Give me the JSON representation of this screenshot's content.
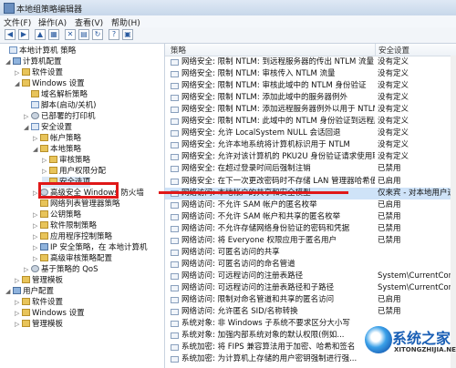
{
  "window": {
    "title": "本地组策略编辑器"
  },
  "menu": [
    "文件(F)",
    "操作(A)",
    "查看(V)",
    "帮助(H)"
  ],
  "tree": [
    {
      "label": "本地计算机 策略",
      "icon": "policy-icon",
      "exp": ""
    },
    {
      "label": "计算机配置",
      "icon": "computer-icon",
      "exp": "◢"
    },
    {
      "label": "软件设置",
      "icon": "folder-icon",
      "exp": "▷"
    },
    {
      "label": "Windows 设置",
      "icon": "folder-icon",
      "exp": "◢"
    },
    {
      "label": "域名解析策略",
      "icon": "folder-icon",
      "exp": ""
    },
    {
      "label": "脚本(启动/关机)",
      "icon": "script-icon",
      "exp": ""
    },
    {
      "label": "已部署的打印机",
      "icon": "printer-icon",
      "exp": "▷"
    },
    {
      "label": "安全设置",
      "icon": "security-icon",
      "exp": "◢"
    },
    {
      "label": "帐户策略",
      "icon": "folder-icon",
      "exp": "▷"
    },
    {
      "label": "本地策略",
      "icon": "folder-icon",
      "exp": "◢"
    },
    {
      "label": "审核策略",
      "icon": "folder-icon",
      "exp": "▷"
    },
    {
      "label": "用户权限分配",
      "icon": "folder-icon",
      "exp": "▷"
    },
    {
      "label": "安全选项",
      "icon": "folder-icon",
      "exp": ""
    },
    {
      "label": "高级安全 Windows 防火墙",
      "icon": "firewall-icon",
      "exp": "▷"
    },
    {
      "label": "网络列表管理器策略",
      "icon": "folder-icon",
      "exp": ""
    },
    {
      "label": "公钥策略",
      "icon": "folder-icon",
      "exp": "▷"
    },
    {
      "label": "软件限制策略",
      "icon": "folder-icon",
      "exp": "▷"
    },
    {
      "label": "应用程序控制策略",
      "icon": "folder-icon",
      "exp": "▷"
    },
    {
      "label": "IP 安全策略，在 本地计算机",
      "icon": "ipsec-icon",
      "exp": "▷"
    },
    {
      "label": "高级审核策略配置",
      "icon": "folder-icon",
      "exp": "▷"
    },
    {
      "label": "基于策略的 QoS",
      "icon": "qos-icon",
      "exp": "▷"
    },
    {
      "label": "管理模板",
      "icon": "folder-icon",
      "exp": "▷"
    },
    {
      "label": "用户配置",
      "icon": "user-icon",
      "exp": "◢"
    },
    {
      "label": "软件设置",
      "icon": "folder-icon",
      "exp": "▷"
    },
    {
      "label": "Windows 设置",
      "icon": "folder-icon",
      "exp": "▷"
    },
    {
      "label": "管理模板",
      "icon": "folder-icon",
      "exp": "▷"
    }
  ],
  "columns": {
    "policy": "策略",
    "setting": "安全设置"
  },
  "policies": [
    {
      "name": "网络安全: 限制 NTLM: 到远程服务器的传出 NTLM 流量",
      "value": "没有定义"
    },
    {
      "name": "网络安全: 限制 NTLM: 审核传入 NTLM 流量",
      "value": "没有定义"
    },
    {
      "name": "网络安全: 限制 NTLM: 审核此域中的 NTLM 身份验证",
      "value": "没有定义"
    },
    {
      "name": "网络安全: 限制 NTLM: 添加此域中的服务器例外",
      "value": "没有定义"
    },
    {
      "name": "网络安全: 限制 NTLM: 添加远程服务器例外以用于 NTLM 身份验证",
      "value": "没有定义"
    },
    {
      "name": "网络安全: 限制 NTLM: 此域中的 NTLM 身份验证到远程服务器...",
      "value": "没有定义"
    },
    {
      "name": "网络安全: 允许 LocalSystem NULL 会话回退",
      "value": "没有定义"
    },
    {
      "name": "网络安全: 允许本地系统将计算机标识用于 NTLM",
      "value": "没有定义"
    },
    {
      "name": "网络安全: 允许对该计算机的 PKU2U 身份验证请求使用联...",
      "value": "没有定义"
    },
    {
      "name": "网络安全: 在超过登录时间后强制注销",
      "value": "已禁用"
    },
    {
      "name": "网络安全: 在下一次更改密码时不存储 LAN 管理器哈希值",
      "value": "已启用"
    },
    {
      "name": "网络访问: 本地帐户的共享和安全模型",
      "value": "仅来宾 - 对本地用户进..."
    },
    {
      "name": "网络访问: 不允许 SAM 帐户的匿名枚举",
      "value": "已启用"
    },
    {
      "name": "网络访问: 不允许 SAM 帐户和共享的匿名枚举",
      "value": "已禁用"
    },
    {
      "name": "网络访问: 不允许存储网络身份验证的密码和凭据",
      "value": "已禁用"
    },
    {
      "name": "网络访问: 将 Everyone 权限应用于匿名用户",
      "value": "已禁用"
    },
    {
      "name": "网络访问: 可匿名访问的共享",
      "value": ""
    },
    {
      "name": "网络访问: 可匿名访问的命名管道",
      "value": ""
    },
    {
      "name": "网络访问: 可远程访问的注册表路径",
      "value": "System\\CurrentContro..."
    },
    {
      "name": "网络访问: 可远程访问的注册表路径和子路径",
      "value": "System\\CurrentContro..."
    },
    {
      "name": "网络访问: 限制对命名管道和共享的匿名访问",
      "value": "已启用"
    },
    {
      "name": "网络访问: 允许匿名 SID/名称转换",
      "value": "已禁用"
    },
    {
      "name": "系统对象: 非 Windows 子系统不要求区分大小写",
      "value": ""
    },
    {
      "name": "系统对象: 加强内部系统对象的默认权限(例如...",
      "value": ""
    },
    {
      "name": "系统加密: 将 FIPS 兼容算法用于加密、哈希和签名",
      "value": ""
    },
    {
      "name": "系统加密: 为计算机上存储的用户密钥强制进行强...",
      "value": ""
    }
  ],
  "watermark": {
    "text": "系统之家",
    "url": "XITONGZHIJIA.NET"
  }
}
